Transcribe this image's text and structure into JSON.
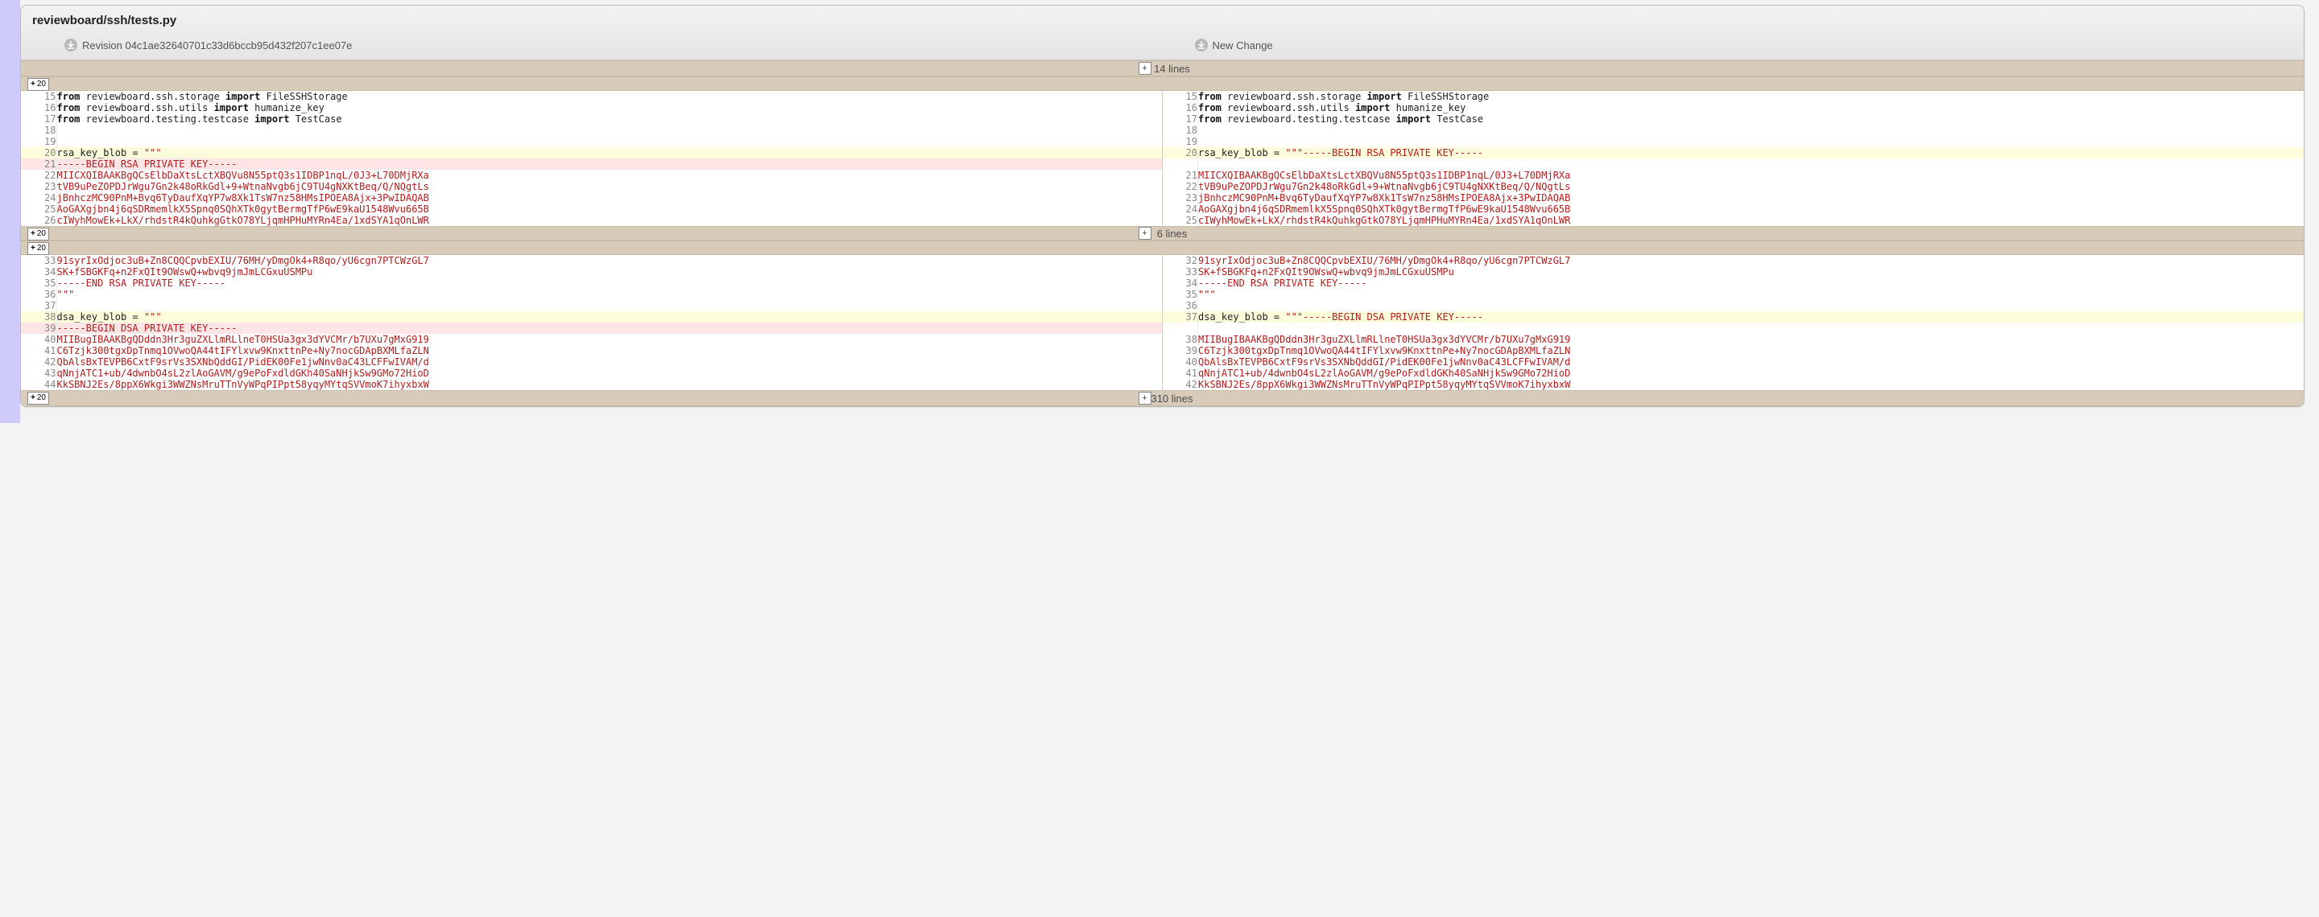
{
  "file": {
    "path": "reviewboard/ssh/tests.py",
    "left_rev_label": "Revision 04c1ae32640701c33d6bccb95d432f207c1ee07e",
    "right_rev_label": "New Change"
  },
  "collapse": {
    "top_lines": "14 lines",
    "mid_lines": "6 lines",
    "bottom_lines": "310 lines",
    "expand_20": "20"
  },
  "chunks": [
    {
      "rows": [
        {
          "type": "equal",
          "ln_l": "15",
          "ln_r": "15",
          "left": [
            {
              "t": "kw",
              "v": "from"
            },
            {
              "t": "p",
              "v": " reviewboard.ssh.storage "
            },
            {
              "t": "kw",
              "v": "import"
            },
            {
              "t": "p",
              "v": " FileSSHStorage"
            }
          ],
          "right": [
            {
              "t": "kw",
              "v": "from"
            },
            {
              "t": "p",
              "v": " reviewboard.ssh.storage "
            },
            {
              "t": "kw",
              "v": "import"
            },
            {
              "t": "p",
              "v": " FileSSHStorage"
            }
          ]
        },
        {
          "type": "equal",
          "ln_l": "16",
          "ln_r": "16",
          "left": [
            {
              "t": "kw",
              "v": "from"
            },
            {
              "t": "p",
              "v": " reviewboard.ssh.utils "
            },
            {
              "t": "kw",
              "v": "import"
            },
            {
              "t": "p",
              "v": " humanize_key"
            }
          ],
          "right": [
            {
              "t": "kw",
              "v": "from"
            },
            {
              "t": "p",
              "v": " reviewboard.ssh.utils "
            },
            {
              "t": "kw",
              "v": "import"
            },
            {
              "t": "p",
              "v": " humanize_key"
            }
          ]
        },
        {
          "type": "equal",
          "ln_l": "17",
          "ln_r": "17",
          "left": [
            {
              "t": "kw",
              "v": "from"
            },
            {
              "t": "p",
              "v": " reviewboard.testing.testcase "
            },
            {
              "t": "kw",
              "v": "import"
            },
            {
              "t": "p",
              "v": " TestCase"
            }
          ],
          "right": [
            {
              "t": "kw",
              "v": "from"
            },
            {
              "t": "p",
              "v": " reviewboard.testing.testcase "
            },
            {
              "t": "kw",
              "v": "import"
            },
            {
              "t": "p",
              "v": " TestCase"
            }
          ]
        },
        {
          "type": "equal",
          "ln_l": "18",
          "ln_r": "18",
          "left": [],
          "right": []
        },
        {
          "type": "equal",
          "ln_l": "19",
          "ln_r": "19",
          "left": [],
          "right": []
        },
        {
          "type": "changed",
          "ln_l": "20",
          "ln_r": "20",
          "left": [
            {
              "t": "p",
              "v": "rsa_key_blob = "
            },
            {
              "t": "str",
              "v": "\"\"\""
            }
          ],
          "right": [
            {
              "t": "p",
              "v": "rsa_key_blob = "
            },
            {
              "t": "str",
              "v": "\"\"\"-----BEGIN RSA PRIVATE KEY-----"
            }
          ]
        },
        {
          "type": "removed",
          "ln_l": "21",
          "ln_r": "",
          "left": [
            {
              "t": "str",
              "v": "-----BEGIN RSA PRIVATE KEY-----"
            }
          ],
          "right": []
        },
        {
          "type": "equal",
          "ln_l": "22",
          "ln_r": "21",
          "left": [
            {
              "t": "str",
              "v": "MIICXQIBAAKBgQCsElbDaXtsLctXBQVu8N55ptQ3s1IDBP1nqL/0J3+L70DMjRXa"
            }
          ],
          "right": [
            {
              "t": "str",
              "v": "MIICXQIBAAKBgQCsElbDaXtsLctXBQVu8N55ptQ3s1IDBP1nqL/0J3+L70DMjRXa"
            }
          ]
        },
        {
          "type": "equal",
          "ln_l": "23",
          "ln_r": "22",
          "left": [
            {
              "t": "str",
              "v": "tVB9uPeZOPDJrWgu7Gn2k48oRkGdl+9+WtnaNvgb6jC9TU4gNXKtBeq/Q/NQgtLs"
            }
          ],
          "right": [
            {
              "t": "str",
              "v": "tVB9uPeZOPDJrWgu7Gn2k48oRkGdl+9+WtnaNvgb6jC9TU4gNXKtBeq/Q/NQgtLs"
            }
          ]
        },
        {
          "type": "equal",
          "ln_l": "24",
          "ln_r": "23",
          "left": [
            {
              "t": "str",
              "v": "jBnhczMC90PnM+Bvq6TyDaufXqYP7w8Xk1TsW7nz58HMsIPOEA8Ajx+3PwIDAQAB"
            }
          ],
          "right": [
            {
              "t": "str",
              "v": "jBnhczMC90PnM+Bvq6TyDaufXqYP7w8Xk1TsW7nz58HMsIPOEA8Ajx+3PwIDAQAB"
            }
          ]
        },
        {
          "type": "equal",
          "ln_l": "25",
          "ln_r": "24",
          "left": [
            {
              "t": "str",
              "v": "AoGAXgjbn4j6qSDRmemlkX5Spnq0SQhXTk0gytBermgTfP6wE9kaU1548Wvu665B"
            }
          ],
          "right": [
            {
              "t": "str",
              "v": "AoGAXgjbn4j6qSDRmemlkX5Spnq0SQhXTk0gytBermgTfP6wE9kaU1548Wvu665B"
            }
          ]
        },
        {
          "type": "equal",
          "ln_l": "26",
          "ln_r": "25",
          "left": [
            {
              "t": "str",
              "v": "cIWyhMowEk+LkX/rhdstR4kQuhkgGtkO78YLjqmHPHuMYRn4Ea/1xdSYA1qOnLWR"
            }
          ],
          "right": [
            {
              "t": "str",
              "v": "cIWyhMowEk+LkX/rhdstR4kQuhkgGtkO78YLjqmHPHuMYRn4Ea/1xdSYA1qOnLWR"
            }
          ]
        }
      ]
    },
    {
      "rows": [
        {
          "type": "equal",
          "ln_l": "33",
          "ln_r": "32",
          "left": [
            {
              "t": "str",
              "v": "91syrIxOdjoc3uB+Zn8CQQCpvbEXIU/76MH/yDmgOk4+R8qo/yU6cgn7PTCWzGL7"
            }
          ],
          "right": [
            {
              "t": "str",
              "v": "91syrIxOdjoc3uB+Zn8CQQCpvbEXIU/76MH/yDmgOk4+R8qo/yU6cgn7PTCWzGL7"
            }
          ]
        },
        {
          "type": "equal",
          "ln_l": "34",
          "ln_r": "33",
          "left": [
            {
              "t": "str",
              "v": "SK+fSBGKFq+n2FxQIt9OWswQ+wbvq9jmJmLCGxuUSMPu"
            }
          ],
          "right": [
            {
              "t": "str",
              "v": "SK+fSBGKFq+n2FxQIt9OWswQ+wbvq9jmJmLCGxuUSMPu"
            }
          ]
        },
        {
          "type": "equal",
          "ln_l": "35",
          "ln_r": "34",
          "left": [
            {
              "t": "str",
              "v": "-----END RSA PRIVATE KEY-----"
            }
          ],
          "right": [
            {
              "t": "str",
              "v": "-----END RSA PRIVATE KEY-----"
            }
          ]
        },
        {
          "type": "equal",
          "ln_l": "36",
          "ln_r": "35",
          "left": [
            {
              "t": "str",
              "v": "\"\"\""
            }
          ],
          "right": [
            {
              "t": "str",
              "v": "\"\"\""
            }
          ]
        },
        {
          "type": "equal",
          "ln_l": "37",
          "ln_r": "36",
          "left": [],
          "right": []
        },
        {
          "type": "changed",
          "ln_l": "38",
          "ln_r": "37",
          "left": [
            {
              "t": "p",
              "v": "dsa_key_blob = "
            },
            {
              "t": "str",
              "v": "\"\"\""
            }
          ],
          "right": [
            {
              "t": "p",
              "v": "dsa_key_blob = "
            },
            {
              "t": "str",
              "v": "\"\"\"-----BEGIN DSA PRIVATE KEY-----"
            }
          ]
        },
        {
          "type": "removed",
          "ln_l": "39",
          "ln_r": "",
          "left": [
            {
              "t": "str",
              "v": "-----BEGIN DSA PRIVATE KEY-----"
            }
          ],
          "right": []
        },
        {
          "type": "equal",
          "ln_l": "40",
          "ln_r": "38",
          "left": [
            {
              "t": "str",
              "v": "MIIBugIBAAKBgQDddn3Hr3guZXLlmRLlneT0HSUa3gx3dYVCMr/b7UXu7gMxG919"
            }
          ],
          "right": [
            {
              "t": "str",
              "v": "MIIBugIBAAKBgQDddn3Hr3guZXLlmRLlneT0HSUa3gx3dYVCMr/b7UXu7gMxG919"
            }
          ]
        },
        {
          "type": "equal",
          "ln_l": "41",
          "ln_r": "39",
          "left": [
            {
              "t": "str",
              "v": "C6Tzjk300tgxDpTnmq1OVwoQA44tIFYlxvw9KnxttnPe+Ny7nocGDApBXMLfaZLN"
            }
          ],
          "right": [
            {
              "t": "str",
              "v": "C6Tzjk300tgxDpTnmq1OVwoQA44tIFYlxvw9KnxttnPe+Ny7nocGDApBXMLfaZLN"
            }
          ]
        },
        {
          "type": "equal",
          "ln_l": "42",
          "ln_r": "40",
          "left": [
            {
              "t": "str",
              "v": "QbAlsBxTEVPB6CxtF9srVs3SXNbQddGI/PidEK00Fe1jwNnv0aC43LCFFwIVAM/d"
            }
          ],
          "right": [
            {
              "t": "str",
              "v": "QbAlsBxTEVPB6CxtF9srVs3SXNbQddGI/PidEK00Fe1jwNnv0aC43LCFFwIVAM/d"
            }
          ]
        },
        {
          "type": "equal",
          "ln_l": "43",
          "ln_r": "41",
          "left": [
            {
              "t": "str",
              "v": "qNnjATC1+ub/4dwnbO4sL2zlAoGAVM/g9ePoFxdldGKh40SaNHjkSw9GMo72HioD"
            }
          ],
          "right": [
            {
              "t": "str",
              "v": "qNnjATC1+ub/4dwnbO4sL2zlAoGAVM/g9ePoFxdldGKh40SaNHjkSw9GMo72HioD"
            }
          ]
        },
        {
          "type": "equal",
          "ln_l": "44",
          "ln_r": "42",
          "left": [
            {
              "t": "str",
              "v": "KkSBNJ2Es/8ppX6Wkgi3WWZNsMruTTnVyWPqPIPpt58yqyMYtqSVVmoK7ihyxbxW"
            }
          ],
          "right": [
            {
              "t": "str",
              "v": "KkSBNJ2Es/8ppX6Wkgi3WWZNsMruTTnVyWPqPIPpt58yqyMYtqSVVmoK7ihyxbxW"
            }
          ]
        }
      ]
    }
  ]
}
